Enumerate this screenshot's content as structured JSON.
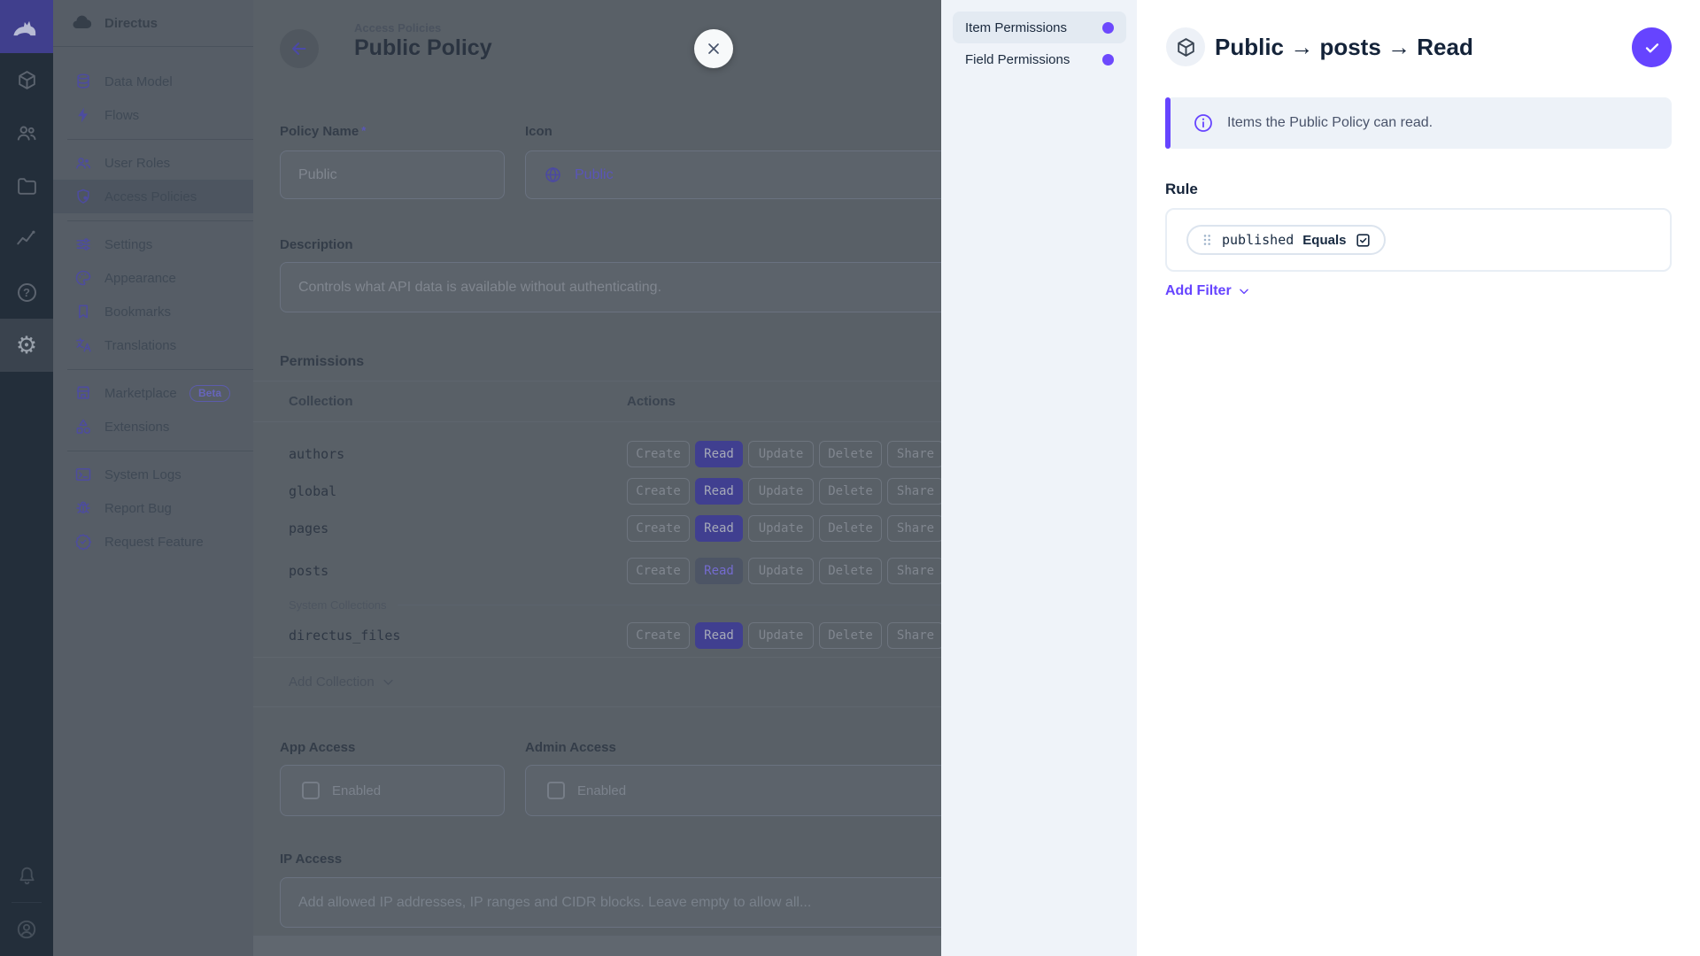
{
  "app": {
    "accent": "#6644ff"
  },
  "nav": {
    "project": "Directus",
    "beta": "Beta",
    "items": [
      {
        "label": "Data Model"
      },
      {
        "label": "Flows"
      },
      {
        "label": "User Roles"
      },
      {
        "label": "Access Policies"
      },
      {
        "label": "Settings"
      },
      {
        "label": "Appearance"
      },
      {
        "label": "Bookmarks"
      },
      {
        "label": "Translations"
      },
      {
        "label": "Marketplace"
      },
      {
        "label": "Extensions"
      },
      {
        "label": "System Logs"
      },
      {
        "label": "Report Bug"
      },
      {
        "label": "Request Feature"
      }
    ]
  },
  "page": {
    "breadcrumb": "Access Policies",
    "title": "Public Policy"
  },
  "form": {
    "policy_name": {
      "label": "Policy Name",
      "required": "*",
      "value": "Public"
    },
    "icon": {
      "label": "Icon",
      "value": "Public"
    },
    "description": {
      "label": "Description",
      "value": "Controls what API data is available without authenticating."
    },
    "app_access": {
      "label": "App Access",
      "enabled_label": "Enabled"
    },
    "admin_access": {
      "label": "Admin Access",
      "enabled_label": "Enabled"
    },
    "ip_access": {
      "label": "IP Access",
      "placeholder": "Add allowed IP addresses, IP ranges and CIDR blocks. Leave empty to allow all..."
    }
  },
  "permissions": {
    "label": "Permissions",
    "columns": [
      "Collection",
      "Actions"
    ],
    "action_labels": [
      "Create",
      "Read",
      "Update",
      "Delete",
      "Share"
    ],
    "rows": [
      {
        "collection": "authors"
      },
      {
        "collection": "global"
      },
      {
        "collection": "pages"
      },
      {
        "collection": "posts"
      }
    ],
    "system_divider": "System Collections",
    "system_rows": [
      {
        "collection": "directus_files"
      }
    ],
    "add_collection": "Add Collection"
  },
  "drawer": {
    "tabs": [
      {
        "label": "Item Permissions"
      },
      {
        "label": "Field Permissions"
      }
    ],
    "title": "Public → posts → Read",
    "notice": "Items the Public Policy can read.",
    "rule_label": "Rule",
    "filter": {
      "field": "published",
      "operator": "Equals"
    },
    "add_filter": "Add Filter"
  }
}
